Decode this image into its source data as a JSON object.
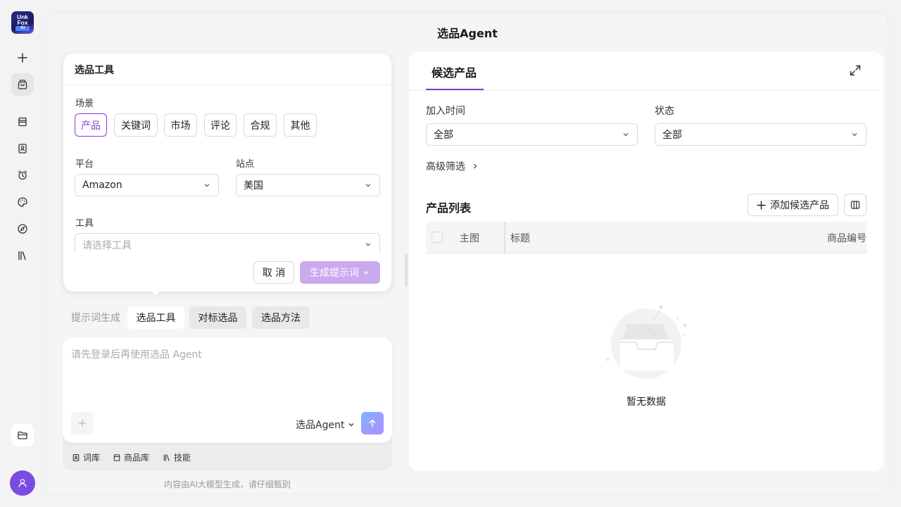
{
  "app": {
    "logo_text_line1": "Unk",
    "logo_text_line2": "Fox",
    "logo_badge": "AI",
    "page_title": "选品Agent"
  },
  "rail": {
    "items": [
      "new-chat",
      "shopping-bag",
      "store",
      "contacts",
      "alarm",
      "palette",
      "compass",
      "library"
    ],
    "bottom": [
      "folder",
      "user"
    ]
  },
  "tool_card": {
    "title": "选品工具",
    "scene_label": "场景",
    "scenes": [
      "产品",
      "关键词",
      "市场",
      "评论",
      "合规",
      "其他"
    ],
    "active_scene": "产品",
    "platform_label": "平台",
    "platform_value": "Amazon",
    "site_label": "站点",
    "site_value": "美国",
    "tool_label": "工具",
    "tool_placeholder": "请选择工具",
    "cancel": "取 消",
    "generate": "生成提示词"
  },
  "prompt_tabs": {
    "label": "提示词生成",
    "tabs": [
      "选品工具",
      "对标选品",
      "选品方法"
    ],
    "active": "选品工具"
  },
  "composer": {
    "placeholder": "请先登录后再使用选品 Agent",
    "agent": "选品Agent",
    "links": [
      "词库",
      "商品库",
      "技能"
    ],
    "disclaimer": "内容由AI大模型生成，请仔细甄别"
  },
  "right_panel": {
    "tab": "候选产品",
    "filters": [
      {
        "label": "加入时间",
        "value": "全部"
      },
      {
        "label": "状态",
        "value": "全部"
      }
    ],
    "advanced": "高级筛选",
    "list_title": "产品列表",
    "add_button": "添加候选产品",
    "columns": [
      "主图",
      "标题",
      "商品编号"
    ],
    "empty": "暂无数据"
  },
  "colors": {
    "accent": "#8b3ad6",
    "generate_button": "#caa9ee",
    "avatar": "#7b4ce0"
  }
}
